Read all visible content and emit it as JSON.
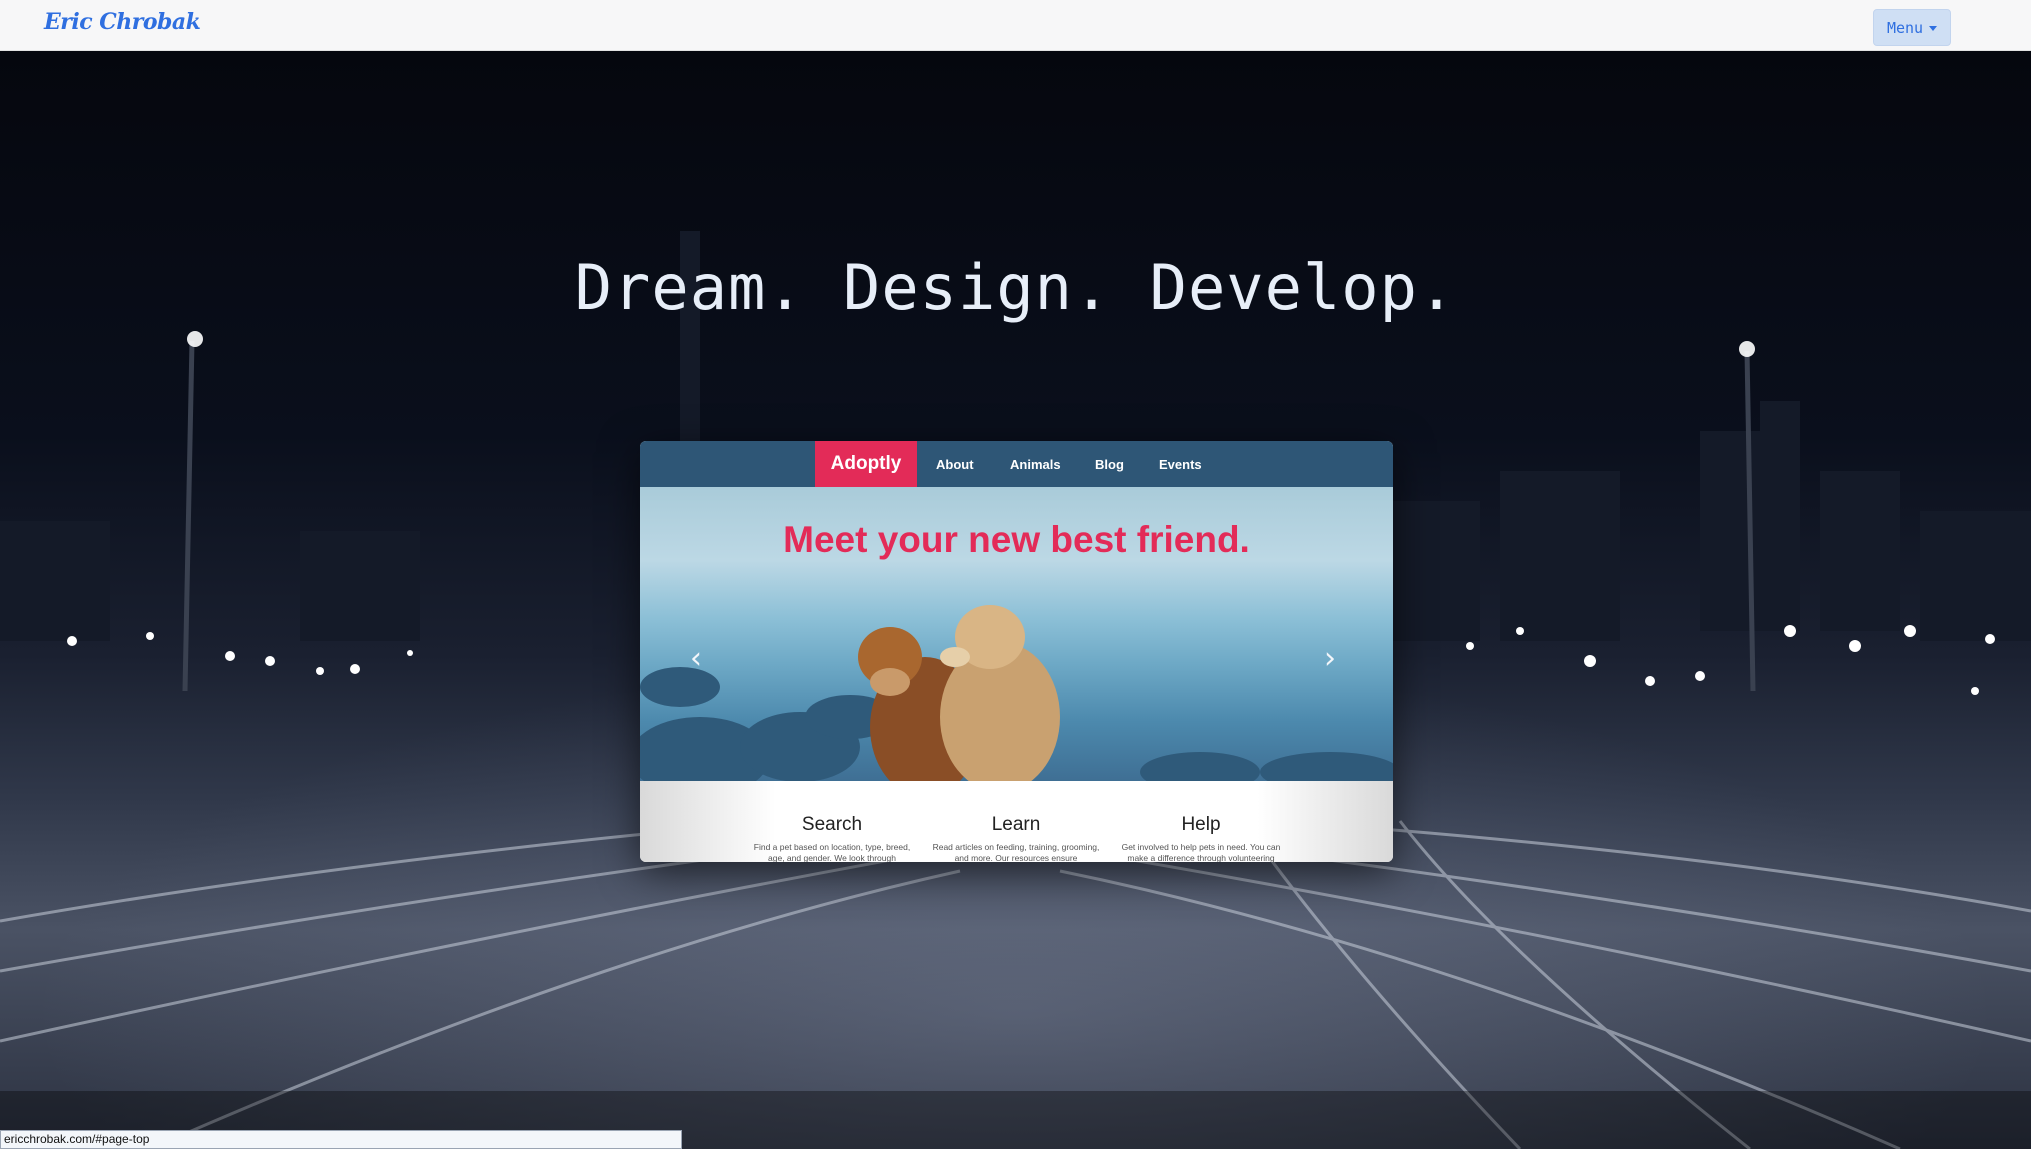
{
  "navbar": {
    "brand": "Eric Chrobak",
    "menu_label": "Menu"
  },
  "hero": {
    "headline": "Dream. Design. Develop."
  },
  "card": {
    "brand": "Adoptly",
    "nav_links": [
      "About",
      "Animals",
      "Blog",
      "Events"
    ],
    "hero_title": "Meet your new best friend.",
    "features": [
      {
        "title": "Search",
        "text": "Find a pet based on location, type, breed, age, and gender. We look through"
      },
      {
        "title": "Learn",
        "text": "Read articles on feeding, training, grooming, and more. Our resources ensure"
      },
      {
        "title": "Help",
        "text": "Get involved to help pets in need. You can make a difference through volunteering"
      }
    ],
    "accent_color": "#e32b58",
    "nav_color": "#2e5676"
  },
  "status_bar": {
    "url": "ericchrobak.com/#page-top"
  }
}
